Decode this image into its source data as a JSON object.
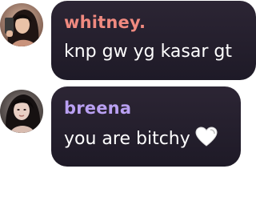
{
  "messages": [
    {
      "username": "whitney.",
      "username_color": "#f08a80",
      "text": "knp gw yg kasar gt",
      "avatar": "profile-photo"
    },
    {
      "username": "breena",
      "username_color": "#b9a0f2",
      "text": "you are bitchy",
      "emoji": "white-heart-icon",
      "avatar": "profile-photo"
    }
  ]
}
